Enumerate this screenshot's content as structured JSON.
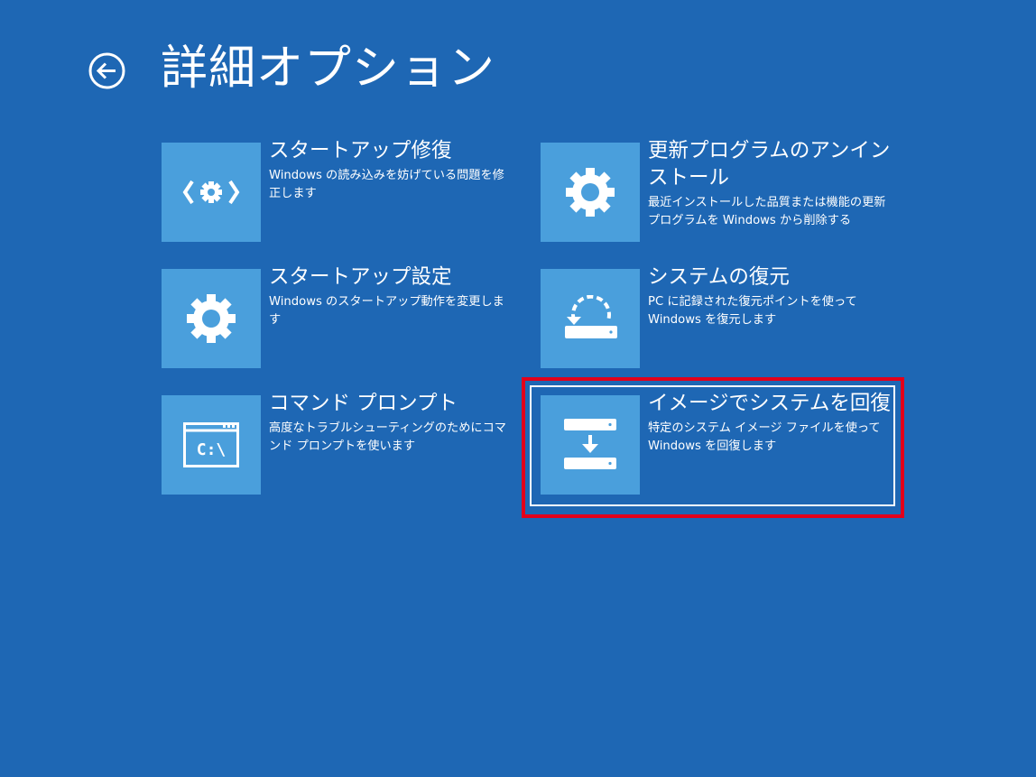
{
  "page": {
    "title": "詳細オプション",
    "back_icon": "back-arrow-circle-icon"
  },
  "colors": {
    "background": "#1e67b4",
    "tile": "#4a9fdc",
    "highlight": "#e3001b",
    "text": "#ffffff"
  },
  "options": [
    {
      "icon": "startup-repair-icon",
      "title": "スタートアップ修復",
      "description": "Windows の読み込みを妨げている問題を修正します"
    },
    {
      "icon": "gear-icon",
      "title": "更新プログラムのアンインストール",
      "description": "最近インストールした品質または機能の更新プログラムを Windows から削除する"
    },
    {
      "icon": "gear-icon",
      "title": "スタートアップ設定",
      "description": "Windows のスタートアップ動作を変更します"
    },
    {
      "icon": "system-restore-icon",
      "title": "システムの復元",
      "description": "PC に記録された復元ポイントを使って Windows を復元します"
    },
    {
      "icon": "command-prompt-icon",
      "icon_text": "C:\\",
      "title": "コマンド プロンプト",
      "description": "高度なトラブルシューティングのためにコマンド プロンプトを使います"
    },
    {
      "icon": "system-image-recovery-icon",
      "title": "イメージでシステムを回復",
      "description": "特定のシステム イメージ ファイルを使って Windows を回復します",
      "focused": true,
      "highlighted": true
    }
  ]
}
